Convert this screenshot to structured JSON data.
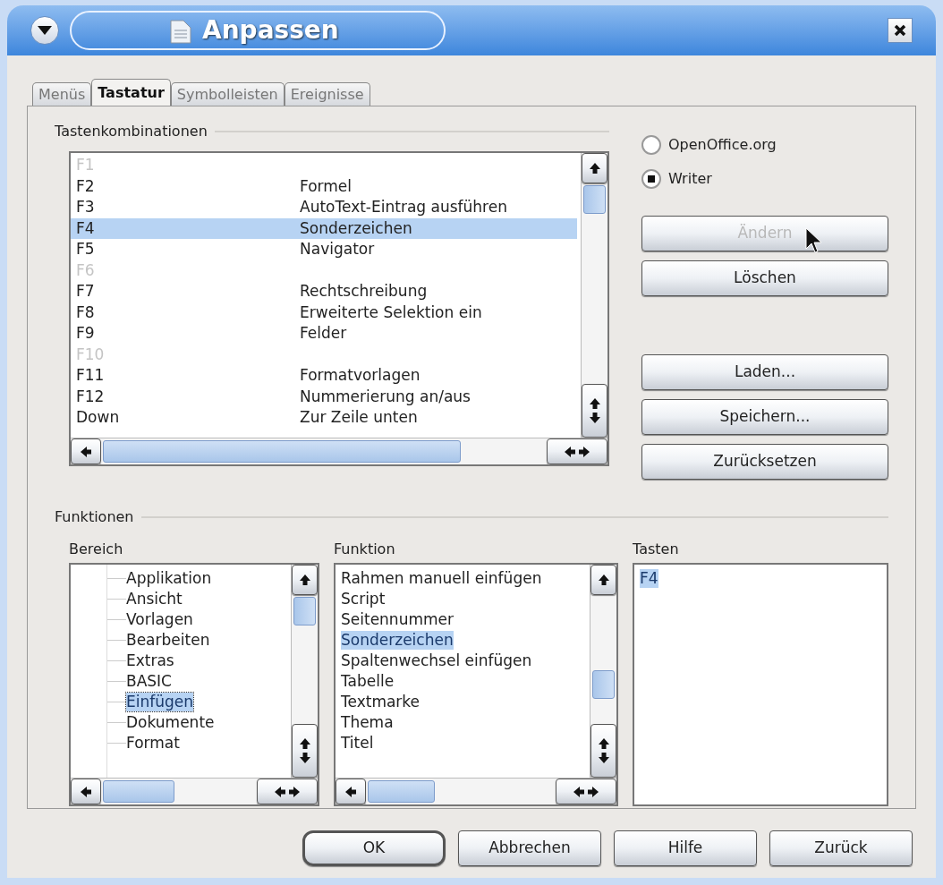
{
  "window": {
    "title": "Anpassen"
  },
  "tabs": [
    {
      "label": "Menüs",
      "selected": false
    },
    {
      "label": "Tastatur",
      "selected": true
    },
    {
      "label": "Symbolleisten",
      "selected": false
    },
    {
      "label": "Ereignisse",
      "selected": false
    }
  ],
  "shortcuts": {
    "label": "Tastenkombinationen",
    "rows": [
      {
        "key": "F1",
        "command": "",
        "disabled": true,
        "selected": false
      },
      {
        "key": "F2",
        "command": "Formel",
        "disabled": false,
        "selected": false
      },
      {
        "key": "F3",
        "command": "AutoText-Eintrag ausführen",
        "disabled": false,
        "selected": false
      },
      {
        "key": "F4",
        "command": "Sonderzeichen",
        "disabled": false,
        "selected": true
      },
      {
        "key": "F5",
        "command": "Navigator",
        "disabled": false,
        "selected": false
      },
      {
        "key": "F6",
        "command": "",
        "disabled": true,
        "selected": false
      },
      {
        "key": "F7",
        "command": "Rechtschreibung",
        "disabled": false,
        "selected": false
      },
      {
        "key": "F8",
        "command": "Erweiterte Selektion ein",
        "disabled": false,
        "selected": false
      },
      {
        "key": "F9",
        "command": "Felder",
        "disabled": false,
        "selected": false
      },
      {
        "key": "F10",
        "command": "",
        "disabled": true,
        "selected": false
      },
      {
        "key": "F11",
        "command": "Formatvorlagen",
        "disabled": false,
        "selected": false
      },
      {
        "key": "F12",
        "command": "Nummerierung an/aus",
        "disabled": false,
        "selected": false
      },
      {
        "key": "Down",
        "command": "Zur Zeile unten",
        "disabled": false,
        "selected": false
      }
    ]
  },
  "scope": [
    {
      "label": "OpenOffice.org",
      "selected": false
    },
    {
      "label": "Writer",
      "selected": true
    }
  ],
  "side_buttons": [
    [
      {
        "label": "Ändern",
        "disabled": true
      },
      {
        "label": "Löschen",
        "disabled": false
      }
    ],
    [
      {
        "label": "Laden...",
        "disabled": false
      },
      {
        "label": "Speichern...",
        "disabled": false
      },
      {
        "label": "Zurücksetzen",
        "disabled": false
      }
    ]
  ],
  "functions": {
    "label": "Funktionen",
    "bereich": {
      "header": "Bereich",
      "items": [
        {
          "label": "Applikation",
          "selected": false
        },
        {
          "label": "Ansicht",
          "selected": false
        },
        {
          "label": "Vorlagen",
          "selected": false
        },
        {
          "label": "Bearbeiten",
          "selected": false
        },
        {
          "label": "Extras",
          "selected": false
        },
        {
          "label": "BASIC",
          "selected": false
        },
        {
          "label": "Einfügen",
          "selected": true
        },
        {
          "label": "Dokumente",
          "selected": false
        },
        {
          "label": "Format",
          "selected": false
        }
      ]
    },
    "funktion": {
      "header": "Funktion",
      "items": [
        {
          "label": "Rahmen manuell einfügen",
          "selected": false
        },
        {
          "label": "Script",
          "selected": false
        },
        {
          "label": "Seitennummer",
          "selected": false
        },
        {
          "label": "Sonderzeichen",
          "selected": true
        },
        {
          "label": "Spaltenwechsel einfügen",
          "selected": false
        },
        {
          "label": "Tabelle",
          "selected": false
        },
        {
          "label": "Textmarke",
          "selected": false
        },
        {
          "label": "Thema",
          "selected": false
        },
        {
          "label": "Titel",
          "selected": false
        }
      ]
    },
    "tasten": {
      "header": "Tasten",
      "items": [
        {
          "label": "F4",
          "selected": true
        }
      ]
    }
  },
  "dialog_buttons": [
    {
      "label": "OK",
      "default": true
    },
    {
      "label": "Abbrechen",
      "default": false
    },
    {
      "label": "Hilfe",
      "default": false
    },
    {
      "label": "Zurück",
      "default": false
    }
  ]
}
